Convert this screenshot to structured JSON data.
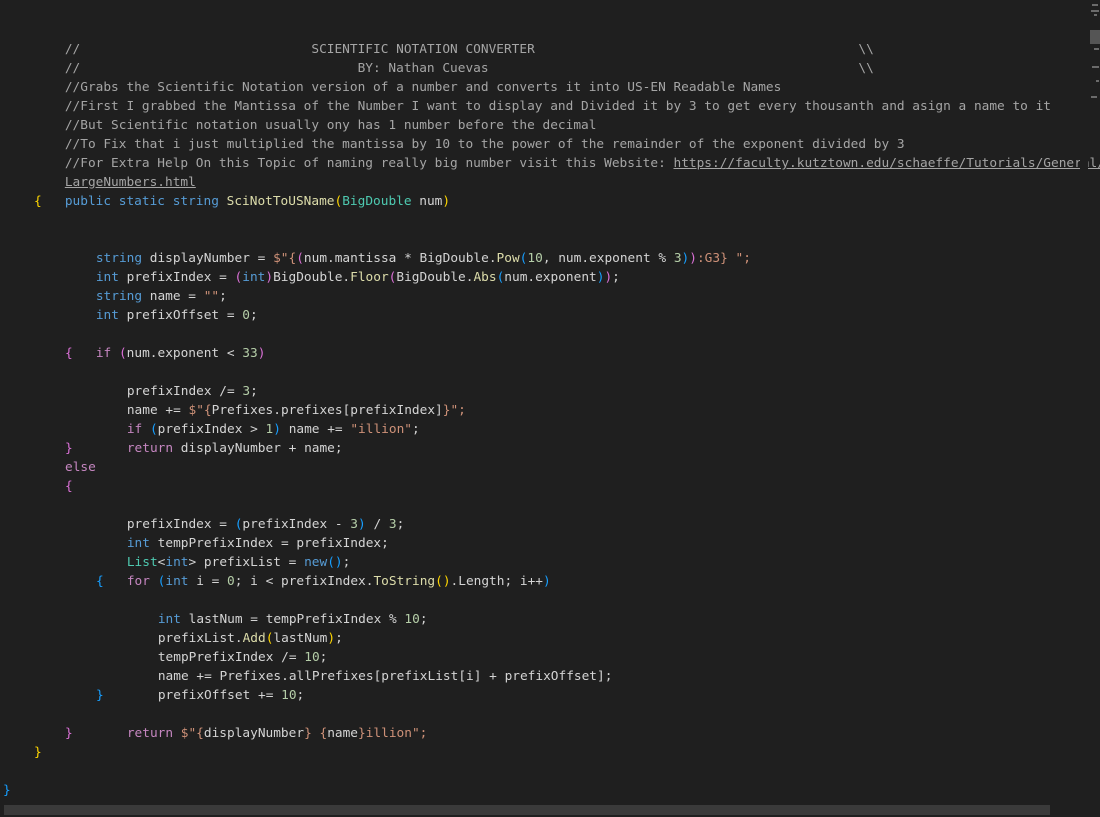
{
  "editor": {
    "header_comment_1": "//                              SCIENTIFIC NOTATION CONVERTER                                          \\\\",
    "header_comment_2": "//                                    BY: Nathan Cuevas                                                \\\\",
    "comment_3": "//Grabs the Scientific Notation version of a number and converts it into US-EN Readable Names",
    "comment_4": "//First I grabbed the Mantissa of the Number I want to display and Divided it by 3 to get every thousanth and asign a name to it",
    "comment_5": "//But Scientific notation usually ony has 1 number before the decimal",
    "comment_6": "//To Fix that i just multiplied the mantissa by 10 to the power of the remainder of the exponent divided by 3",
    "comment_7_prefix": "//For Extra Help On this Topic of naming really big number visit this Website: ",
    "link_part1": "https://faculty.kutztown.edu/schaeffe/Tutorials/General/",
    "link_part2": "LargeNumbers.html"
  },
  "colors": {
    "background": "#1f1f1f",
    "keyword": "#569cd6",
    "control_keyword": "#c586c0",
    "string": "#ce9178",
    "function": "#dcdcaa",
    "type": "#4ec9b0",
    "number": "#b5cea8",
    "comment": "#a5a5a5"
  }
}
